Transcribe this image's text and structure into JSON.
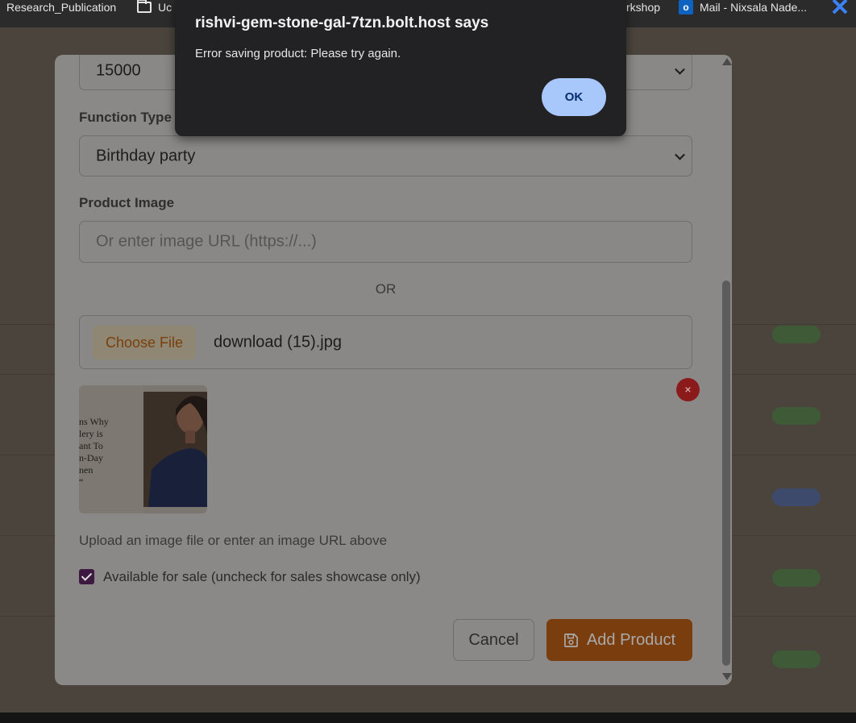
{
  "bookmarks": {
    "items": [
      {
        "label": "Research_Publication",
        "icon": "none"
      },
      {
        "label": "Uc",
        "icon": "folder-icon"
      },
      {
        "label": "rkshop",
        "icon": "none"
      },
      {
        "label": "Mail - Nixsala Nade...",
        "icon": "outlook-icon"
      }
    ]
  },
  "modal": {
    "price_value": "15000",
    "function_type_label": "Function Type",
    "function_type_value": "Birthday party",
    "product_image_label": "Product Image",
    "image_url_placeholder": "Or enter image URL (https://...)",
    "or_text": "OR",
    "choose_file_label": "Choose File",
    "file_name": "download (15).jpg",
    "thumbnail_text": "ns Why\nlery is\nant To\nn-Day\nnen\n“",
    "remove_image_symbol": "×",
    "upload_hint": "Upload an image file or enter an image URL above",
    "available_checked": true,
    "available_label": "Available for sale (uncheck for sales showcase only)",
    "cancel_label": "Cancel",
    "add_product_label": "Add Product"
  },
  "alert": {
    "title": "rishvi-gem-stone-gal-7tzn.bolt.host says",
    "message": "Error saving product: Please try again.",
    "ok_label": "OK"
  },
  "colors": {
    "accent_orange": "#ea6a0c",
    "ok_button": "#a8c7fa",
    "checkbox": "#6b2a6f",
    "remove_button": "#dc2626"
  }
}
